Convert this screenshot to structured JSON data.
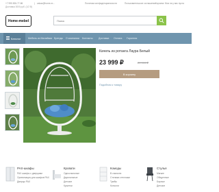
{
  "topbar": {
    "phone": "+7 995 826-77-86",
    "separator": "|",
    "email": "zakaz@home-m...",
    "delivery": "Доставка 3000 руб. (1/2 В)",
    "privacy": "Политика конфиденциальности",
    "agreement": "Пользовательское соглашение",
    "cart": "Корзина: Моя на у вас пуста"
  },
  "header": {
    "logo": "Home-mebel",
    "search_placeholder": "Поиск"
  },
  "nav": {
    "catalog": "Каталог",
    "items": [
      "Мебель из Малайзии",
      "Бренды",
      "О компании",
      "Контакты",
      "Доставка",
      "Оплата",
      "Гарантия"
    ]
  },
  "product": {
    "title": "Качель из ротанга Лаура Белый",
    "price": "23 999 ₽",
    "old_price": "29 999 ₽",
    "cart_button": "В корзину",
    "favorite": "Подобная к товару"
  },
  "categories": [
    {
      "name": "PAX-шкафы",
      "subs": [
        "PAX шкафы с дверцами",
        "Организация для шкафов PAX",
        "Дверцы PAX",
        ""
      ]
    },
    {
      "name": "Кровати",
      "subs": [
        "Односпальные",
        "Двуспальные",
        "Детские",
        "Кушетки"
      ]
    },
    {
      "name": "Комоды",
      "subs": [
        "В спальню",
        "Стелажи стеллажи",
        "Тумбы",
        "Консоли"
      ]
    },
    {
      "name": "Стулья",
      "subs": [
        "Мягкие",
        "Обеденные",
        "Барные",
        "Детские"
      ]
    }
  ],
  "colors": {
    "nav_bg": "#6f95ae",
    "cart_button": "#b59c80",
    "search_button": "#8bc34a",
    "link": "#6f95ae"
  },
  "icons": [
    "search-icon",
    "burger-menu-icon",
    "wardrobe-icon",
    "bed-icon",
    "dresser-icon",
    "chair-icon"
  ]
}
